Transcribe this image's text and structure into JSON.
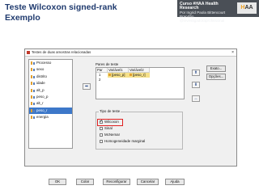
{
  "slide": {
    "title_line1": "Teste Wilcoxon signed-rank",
    "title_line2": "Exemplo"
  },
  "banner": {
    "line1": "Curso #HAA Health Research",
    "line2": "Por Ingrid Paola Bittencourt Brandão",
    "line3": "@investigadoraprofissional",
    "logo_a": "H",
    "logo_b": "AA"
  },
  "dialog": {
    "title": "Testes de duas amostras relacionadas",
    "close": "×",
    "variables": [
      "Processo",
      "sexo",
      "distrito",
      "idade",
      "alt_p",
      "peso_p",
      "alt_r",
      "peso_r",
      "energia"
    ],
    "selected_variable": "peso_r",
    "arrows": {
      "move": "➡",
      "up": "⬆",
      "down": "⬇",
      "swap": "↔"
    },
    "pairs": {
      "label": "Pares de teste",
      "columns": [
        "Par",
        "Variável1",
        "Variável2"
      ],
      "rows": [
        {
          "num": "1",
          "var1": "[peso_p]",
          "var2": "[peso_r]"
        },
        {
          "num": "2",
          "var1": "",
          "var2": ""
        }
      ]
    },
    "test_type": {
      "label": "Tipo de teste",
      "options": [
        {
          "label": "Wilcoxon",
          "checked": true
        },
        {
          "label": "Sinal",
          "checked": false
        },
        {
          "label": "McNemar",
          "checked": false
        },
        {
          "label": "Homogeneidade marginal",
          "checked": false
        }
      ]
    },
    "side_buttons": {
      "exact": "Exato...",
      "options": "Opções..."
    },
    "buttons": {
      "ok": "OK",
      "paste": "Colar",
      "reset": "Reconfigurar",
      "cancel": "Cancelar",
      "help": "Ajuda"
    }
  }
}
